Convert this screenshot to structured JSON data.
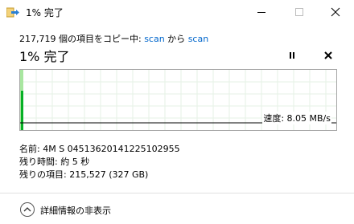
{
  "window": {
    "title": "1% 完了"
  },
  "header": {
    "copy_prefix": "217,719 個の項目をコピー中: ",
    "source": "scan",
    "from_word": " から ",
    "destination": "scan",
    "progress_title": "1% 完了"
  },
  "progress": {
    "percent": 1,
    "speed_label": "速度: 8.05 MB/s",
    "fill_color": "#a8e6a0",
    "bar_color": "#06b025",
    "speed_line_color": "#000000"
  },
  "details": {
    "name_label": "名前:",
    "name_value": "4M S 04513620141225102955",
    "time_label": "残り時間:",
    "time_value": "約 5 秒",
    "items_label": "残りの項目:",
    "items_value": "215,527 (327 GB)"
  },
  "footer": {
    "toggle_label": "詳細情報の非表示",
    "toggle_icon": "chevron-up-icon"
  }
}
